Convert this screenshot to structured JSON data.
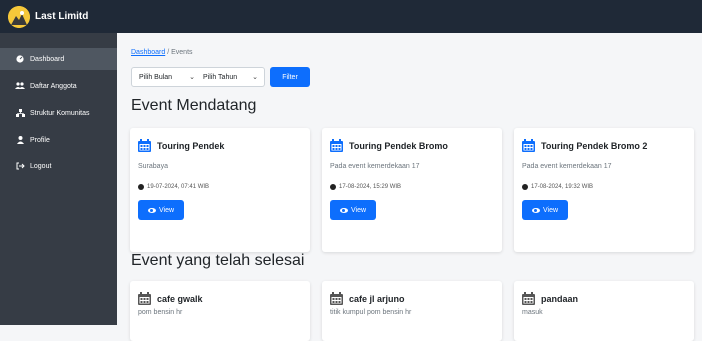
{
  "app": {
    "brand": "Last Limitd"
  },
  "sidebar": {
    "items": [
      {
        "label": "Dashboard",
        "icon": "dashboard-icon",
        "active": true
      },
      {
        "label": "Daftar Anggota",
        "icon": "users-icon",
        "active": false
      },
      {
        "label": "Struktur Komunitas",
        "icon": "sitemap-icon",
        "active": false
      },
      {
        "label": "Profile",
        "icon": "user-icon",
        "active": false
      },
      {
        "label": "Logout",
        "icon": "logout-icon",
        "active": false
      }
    ]
  },
  "breadcrumb": {
    "link": "Dashboard",
    "separator": "/",
    "current": "Events"
  },
  "filters": {
    "month": "Pilih Bulan",
    "year": "Pilih Tahun",
    "button": "Filter"
  },
  "upcoming": {
    "title": "Event Mendatang",
    "events": [
      {
        "title": "Touring Pendek",
        "subtitle": "Surabaya",
        "date": "19-07-2024, 07:41 WIB",
        "button": "View"
      },
      {
        "title": "Touring Pendek Bromo",
        "subtitle": "Pada event kemerdekaan 17",
        "date": "17-08-2024, 15:29 WIB",
        "button": "View"
      },
      {
        "title": "Touring Pendek Bromo 2",
        "subtitle": "Pada event kemerdekaan 17",
        "date": "17-08-2024, 19:32 WIB",
        "button": "View"
      }
    ]
  },
  "past": {
    "title": "Event yang telah selesai",
    "events": [
      {
        "title": "cafe gwalk",
        "subtitle": "pom bensin hr"
      },
      {
        "title": "cafe jl arjuno",
        "subtitle": "titik kumpul pom bensin hr"
      },
      {
        "title": "pandaan",
        "subtitle": "masuk"
      }
    ]
  },
  "colors": {
    "topbar": "#1f2937",
    "sidebar": "#363c45",
    "sidebar_active": "#4f5761",
    "primary": "#0d6efd",
    "background": "#f5f6f8"
  }
}
